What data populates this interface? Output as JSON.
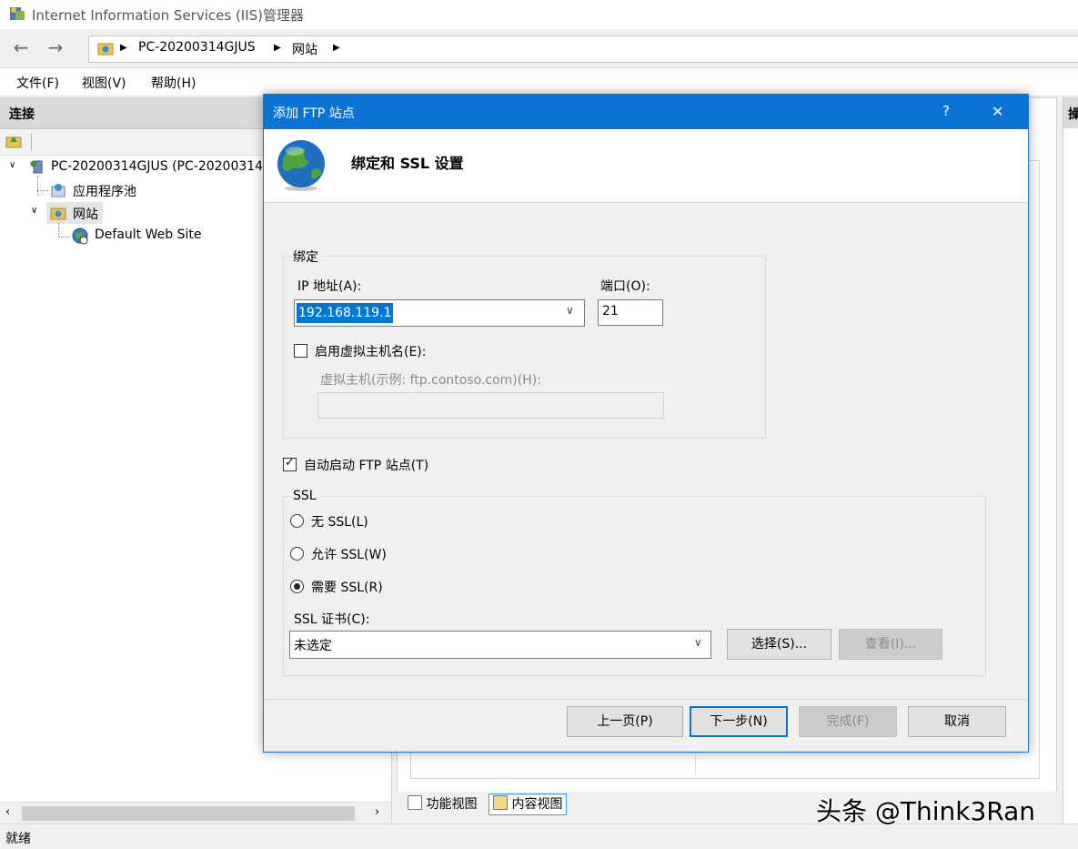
{
  "window": {
    "title": "Internet Information Services (IIS)管理器"
  },
  "address": {
    "crumbs": [
      "PC-20200314GJUS",
      "网站"
    ]
  },
  "menu": {
    "items": [
      "文件(F)",
      "视图(V)",
      "帮助(H)"
    ]
  },
  "connections": {
    "header": "连接",
    "tree": {
      "server": "PC-20200314GJUS (PC-20200314",
      "app_pools": "应用程序池",
      "sites": "网站",
      "default_site": "Default Web Site"
    }
  },
  "actions_header": "操",
  "views": {
    "features": "功能视图",
    "content": "内容视图"
  },
  "status": "就绪",
  "watermark": "头条 @Think3Ran",
  "dialog": {
    "title": "添加 FTP 站点",
    "help": "?",
    "close": "✕",
    "heading": "绑定和 SSL 设置",
    "binding": {
      "group_label": "绑定",
      "ip_label": "IP 地址(A):",
      "ip_value": "192.168.119.1",
      "port_label": "端口(O):",
      "port_value": "21",
      "vhost_enable_label": "启用虚拟主机名(E):",
      "vhost_enabled": false,
      "vhost_label": "虚拟主机(示例: ftp.contoso.com)(H):",
      "vhost_value": ""
    },
    "auto_start_label": "自动启动 FTP 站点(T)",
    "auto_start_checked": true,
    "ssl": {
      "group_label": "SSL",
      "options": [
        "无 SSL(L)",
        "允许 SSL(W)",
        "需要 SSL(R)"
      ],
      "selected": "需要 SSL(R)",
      "cert_label": "SSL 证书(C):",
      "cert_value": "未选定",
      "select_button": "选择(S)...",
      "view_button": "查看(I)..."
    },
    "buttons": {
      "prev": "上一页(P)",
      "next": "下一步(N)",
      "finish": "完成(F)",
      "cancel": "取消"
    }
  }
}
